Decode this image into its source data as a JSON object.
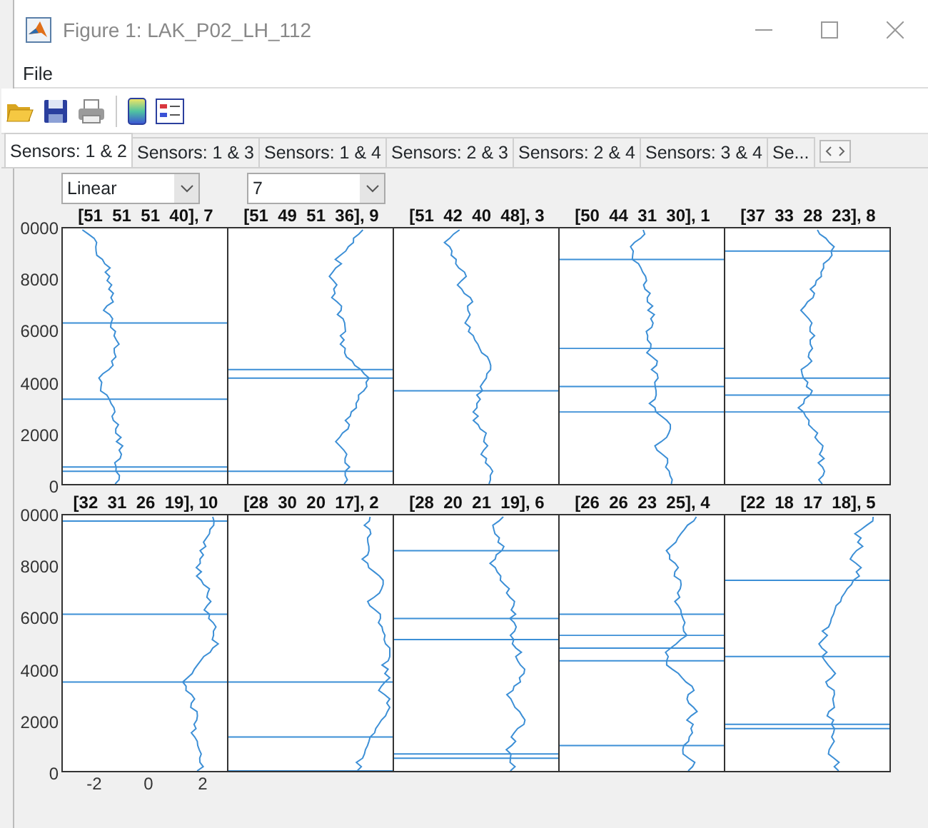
{
  "window": {
    "title": "Figure 1: LAK_P02_LH_112"
  },
  "menu": [
    "File"
  ],
  "tabs": [
    {
      "label": "Sensors: 1 & 2",
      "selected": true
    },
    {
      "label": "Sensors: 1 & 3",
      "selected": false
    },
    {
      "label": "Sensors: 1 & 4",
      "selected": false
    },
    {
      "label": "Sensors: 2 & 3",
      "selected": false
    },
    {
      "label": "Sensors: 2 & 4",
      "selected": false
    },
    {
      "label": "Sensors: 3 & 4",
      "selected": false
    },
    {
      "label": "Se...",
      "selected": false
    }
  ],
  "dropdowns": [
    {
      "value": "Linear"
    },
    {
      "value": "7"
    }
  ],
  "rows": [
    {
      "y_ticks": [
        "0000",
        "8000",
        "6000",
        "4000",
        "2000",
        "0"
      ],
      "plots": [
        {
          "title": "[51  51  51  40], 7"
        },
        {
          "title": "[51  49  51  36], 9"
        },
        {
          "title": "[51  42  40  48], 3"
        },
        {
          "title": "[50  44  31  30], 1"
        },
        {
          "title": "[37  33  28  23], 8"
        }
      ]
    },
    {
      "y_ticks": [
        "0000",
        "8000",
        "6000",
        "4000",
        "2000",
        "0"
      ],
      "plots": [
        {
          "title": "[32  31  26  19], 10"
        },
        {
          "title": "[28  30  20  17], 2"
        },
        {
          "title": "[28  20  21  19], 6"
        },
        {
          "title": "[26  26  23  25], 4"
        },
        {
          "title": "[22  18  17  18], 5"
        }
      ],
      "x_ticks": [
        "-2",
        "0",
        "2"
      ]
    }
  ]
}
